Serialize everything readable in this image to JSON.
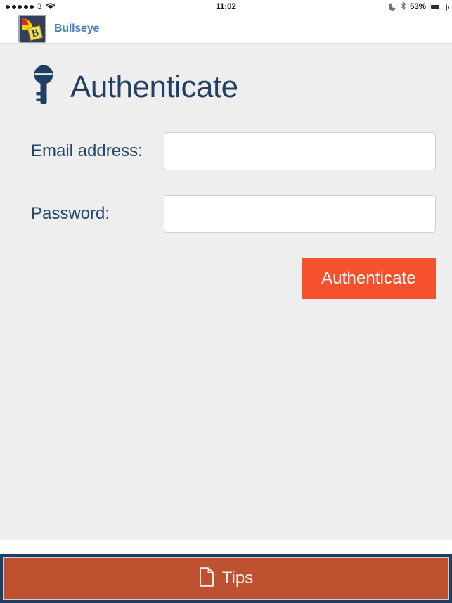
{
  "statusbar": {
    "signal_dots": 5,
    "carrier_label": "3",
    "wifi_icon": "wifi-icon",
    "time": "11:02",
    "dnd_icon": "moon-icon",
    "bluetooth_icon": "bluetooth-icon",
    "battery_percent": "53%",
    "battery_level": 53
  },
  "header": {
    "logo_icon": "bullseye-logo-icon",
    "brand_name": "Bullseye",
    "logo_letter": "B"
  },
  "page": {
    "icon": "key-icon",
    "title": "Authenticate"
  },
  "form": {
    "email": {
      "label": "Email address:",
      "value": "",
      "placeholder": ""
    },
    "password": {
      "label": "Password:",
      "value": "",
      "placeholder": ""
    },
    "submit_label": "Authenticate"
  },
  "bottombar": {
    "icon": "document-icon",
    "label": "Tips"
  },
  "colors": {
    "accent_orange": "#f4512c",
    "brand_blue": "#4b7cc0",
    "title_navy": "#1f4063",
    "label_navy": "#21486b",
    "page_bg": "#eeeeee",
    "tipsbar_fill": "#bd5130",
    "tipsbar_border": "#1c3f63"
  }
}
